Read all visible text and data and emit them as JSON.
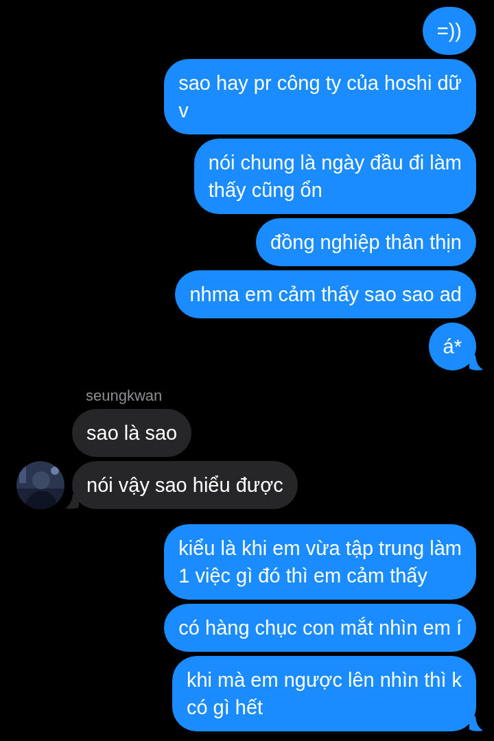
{
  "messages": [
    {
      "kind": "outgoing",
      "text": "=))",
      "tail": false
    },
    {
      "kind": "outgoing",
      "text": "sao hay pr công ty của hoshi dữ\nv",
      "tail": false
    },
    {
      "kind": "outgoing",
      "text": "nói chung là ngày đầu đi làm\nthấy cũng ổn",
      "tail": false
    },
    {
      "kind": "outgoing",
      "text": "đồng nghiệp thân thịn",
      "tail": false
    },
    {
      "kind": "outgoing",
      "text": "nhma em cảm thấy sao sao ad",
      "tail": false
    },
    {
      "kind": "outgoing",
      "text": "á*",
      "tail": true
    },
    {
      "kind": "sender",
      "text": "seungkwan"
    },
    {
      "kind": "incoming",
      "text": "sao là sao",
      "tail": false
    },
    {
      "kind": "incoming",
      "text": "nói vậy sao hiểu được",
      "tail": true
    },
    {
      "kind": "outgoing",
      "text": "kiểu là khi em vừa tập trung làm\n1 việc gì đó thì em cảm thấy",
      "tail": false
    },
    {
      "kind": "outgoing",
      "text": "có hàng chục con mắt nhìn em í",
      "tail": false
    },
    {
      "kind": "outgoing",
      "text": "khi mà em ngược lên nhìn thì k\ncó gì hết",
      "tail": true
    }
  ]
}
